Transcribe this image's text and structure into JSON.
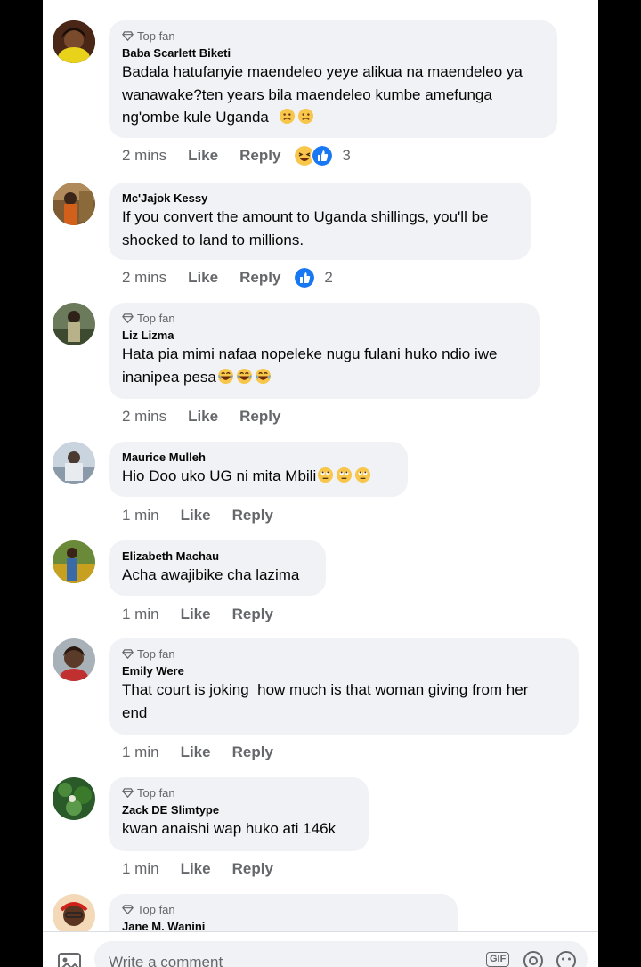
{
  "comments": [
    {
      "top_fan": "Top fan",
      "author": "Baba Scarlett Biketi",
      "lines": [
        "Badala hatufanyie maendeleo yeye alikua na maendeleo ya",
        "wanawake?ten years bila maendeleo kumbe amefunga",
        "ng'ombe kule Uganda"
      ],
      "time": "2 mins",
      "like": "Like",
      "reply": "Reply",
      "reaction_count": "3"
    },
    {
      "author": "Mc'Jajok Kessy",
      "lines": [
        "If you convert the amount to Uganda shillings, you'll be",
        "shocked to land to millions."
      ],
      "time": "2 mins",
      "like": "Like",
      "reply": "Reply",
      "reaction_count": "2"
    },
    {
      "top_fan": "Top fan",
      "author": "Liz Lizma",
      "lines": [
        "Hata pia mimi nafaa nopeleke nugu fulani huko ndio iwe",
        "inanipea pesa"
      ],
      "time": "2 mins",
      "like": "Like",
      "reply": "Reply"
    },
    {
      "author": "Maurice Mulleh",
      "lines": [
        "Hio Doo uko UG ni mita Mbili"
      ],
      "time": "1 min",
      "like": "Like",
      "reply": "Reply"
    },
    {
      "author": "Elizabeth Machau",
      "lines": [
        "Acha awajibike cha lazima"
      ],
      "time": "1 min",
      "like": "Like",
      "reply": "Reply"
    },
    {
      "top_fan": "Top fan",
      "author": "Emily Were",
      "lines": [
        "That court is joking  how much is that woman giving from her",
        "end"
      ],
      "time": "1 min",
      "like": "Like",
      "reply": "Reply"
    },
    {
      "top_fan": "Top fan",
      "author": "Zack DE Slimtype",
      "lines": [
        "kwan anaishi wap huko ati 146k"
      ],
      "time": "1 min",
      "like": "Like",
      "reply": "Reply"
    },
    {
      "top_fan": "Top fan",
      "author": "Jane M. Wanini"
    }
  ],
  "composer": {
    "placeholder": "Write a comment",
    "gif_label": "GIF",
    "icons": [
      "photo-icon",
      "gif-icon",
      "sticker-icon",
      "emoji-icon"
    ]
  },
  "colors": {
    "bubble": "#f0f2f5",
    "text": "#050505",
    "secondary": "#65676b",
    "like_blue": "#1877f2",
    "emoji_yellow": "#f7c64b"
  }
}
